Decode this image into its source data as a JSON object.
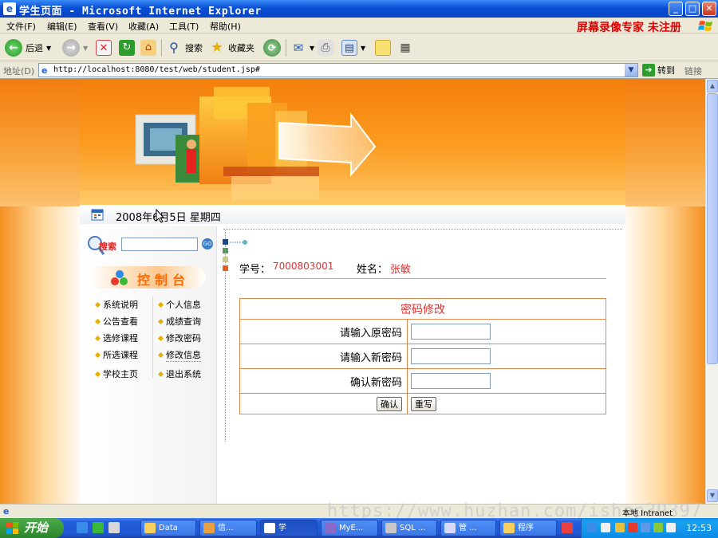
{
  "window": {
    "title": "学生页面 - Microsoft Internet Explorer"
  },
  "menubar": {
    "items": [
      "文件(F)",
      "编辑(E)",
      "查看(V)",
      "收藏(A)",
      "工具(T)",
      "帮助(H)"
    ],
    "brand": "屏幕录像专家  未注册"
  },
  "toolbar": {
    "back_label": "后退",
    "search_label": "搜索",
    "favorites_label": "收藏夹"
  },
  "addressbar": {
    "label": "地址(D)",
    "url": "http://localhost:8080/test/web/student.jsp#",
    "go_label": "转到",
    "links_label": "链接"
  },
  "page": {
    "date": "2008年6月5日  星期四",
    "sidebar": {
      "search_badge": "搜索",
      "go_label": "GO",
      "console_title": "控制台",
      "nav_left": [
        "系统说明",
        "公告查看",
        "选修课程",
        "所选课程",
        "学校主页"
      ],
      "nav_right": [
        "个人信息",
        "成绩查询",
        "修改密码",
        "修改信息",
        "退出系统"
      ]
    },
    "student": {
      "id_label": "学号：",
      "id_value": "7000803001",
      "name_label": "姓名：",
      "name_value": "张敏"
    },
    "password_form": {
      "title": "密码修改",
      "old_label": "请输入原密码",
      "new_label": "请输入新密码",
      "confirm_label": "确认新密码",
      "submit_label": "确认",
      "reset_label": "重写"
    }
  },
  "statusbar": {
    "zone": "本地 Intranet",
    "watermark": "https://www.huzhan.com/ishop39397"
  },
  "taskbar": {
    "start_label": "开始",
    "tasks": [
      "Data",
      "信...",
      "学",
      "MyE...",
      "SQL ...",
      "管 ...",
      "程序"
    ],
    "clock": "12:53"
  },
  "colors": {
    "accent_orange": "#f39020",
    "value_red": "#e03030",
    "table_border": "#e0894c"
  }
}
